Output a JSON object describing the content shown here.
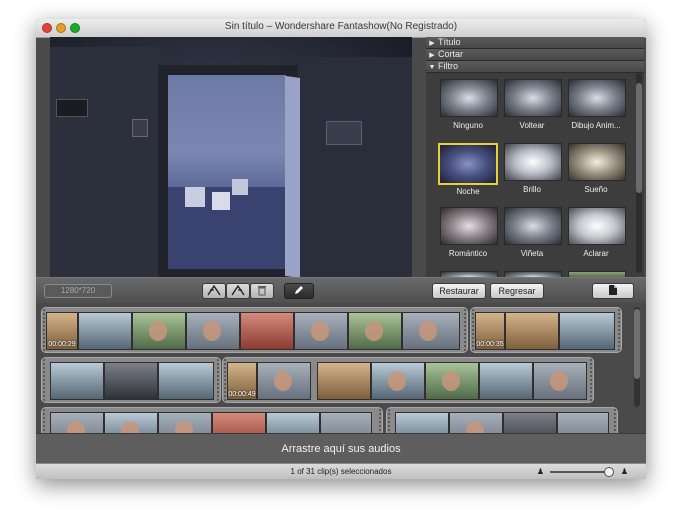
{
  "window": {
    "title": "Sin título – Wondershare Fantashow(No Registrado)"
  },
  "panel": {
    "sections": [
      {
        "label": "Título",
        "expanded": false
      },
      {
        "label": "Cortar",
        "expanded": false
      },
      {
        "label": "Filtro",
        "expanded": true
      }
    ],
    "filters": [
      {
        "label": "Ninguno",
        "selected": false
      },
      {
        "label": "Voltear",
        "selected": false
      },
      {
        "label": "Dibujo Anim...",
        "selected": false
      },
      {
        "label": "Noche",
        "selected": true
      },
      {
        "label": "Brillo",
        "selected": false
      },
      {
        "label": "Sueño",
        "selected": false
      },
      {
        "label": "Romántico",
        "selected": false
      },
      {
        "label": "Viñeta",
        "selected": false
      },
      {
        "label": "Aclarar",
        "selected": false
      }
    ]
  },
  "toolbar": {
    "resolution": "1280*720",
    "restore_label": "Restaurar",
    "back_label": "Regresar",
    "icons": [
      "crop-left-icon",
      "crop-right-icon",
      "trash-icon",
      "pencil-icon",
      "export-icon"
    ]
  },
  "timeline": {
    "timecodes": [
      "00:00:29",
      "00:00:35",
      "00:00:49"
    ]
  },
  "audio": {
    "drop_label": "Arrastre aquí sus audios"
  },
  "status": {
    "text": "1 of 31 clip(s) seleccionados"
  }
}
